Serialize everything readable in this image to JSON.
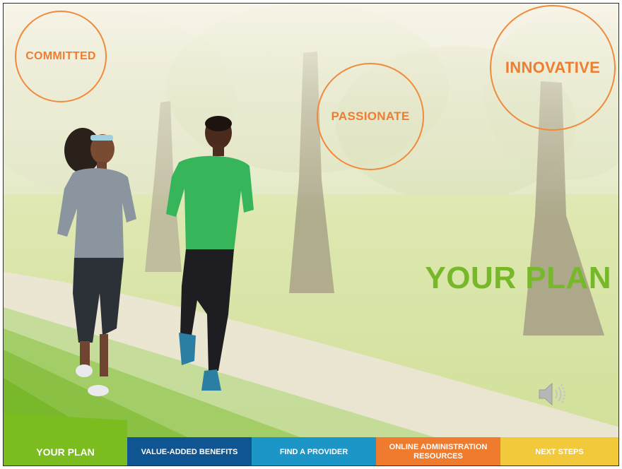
{
  "circles": {
    "committed": "COMMITTED",
    "passionate": "PASSIONATE",
    "innovative": "INNOVATIVE"
  },
  "headline": "YOUR PLAN",
  "audio": {
    "icon": "speaker-icon"
  },
  "nav": {
    "items": [
      {
        "label": "YOUR PLAN",
        "color": "#7bbd1f"
      },
      {
        "label": "VALUE-ADDED BENEFITS",
        "color": "#0e5592"
      },
      {
        "label": "FIND A PROVIDER",
        "color": "#1b96c6"
      },
      {
        "label": "ONLINE ADMINISTRATION RESOURCES",
        "color": "#ef7b2e"
      },
      {
        "label": "NEXT STEPS",
        "color": "#f1c93b"
      }
    ]
  },
  "colors": {
    "accent_orange": "#ef7d2f",
    "accent_green": "#77b82a"
  }
}
